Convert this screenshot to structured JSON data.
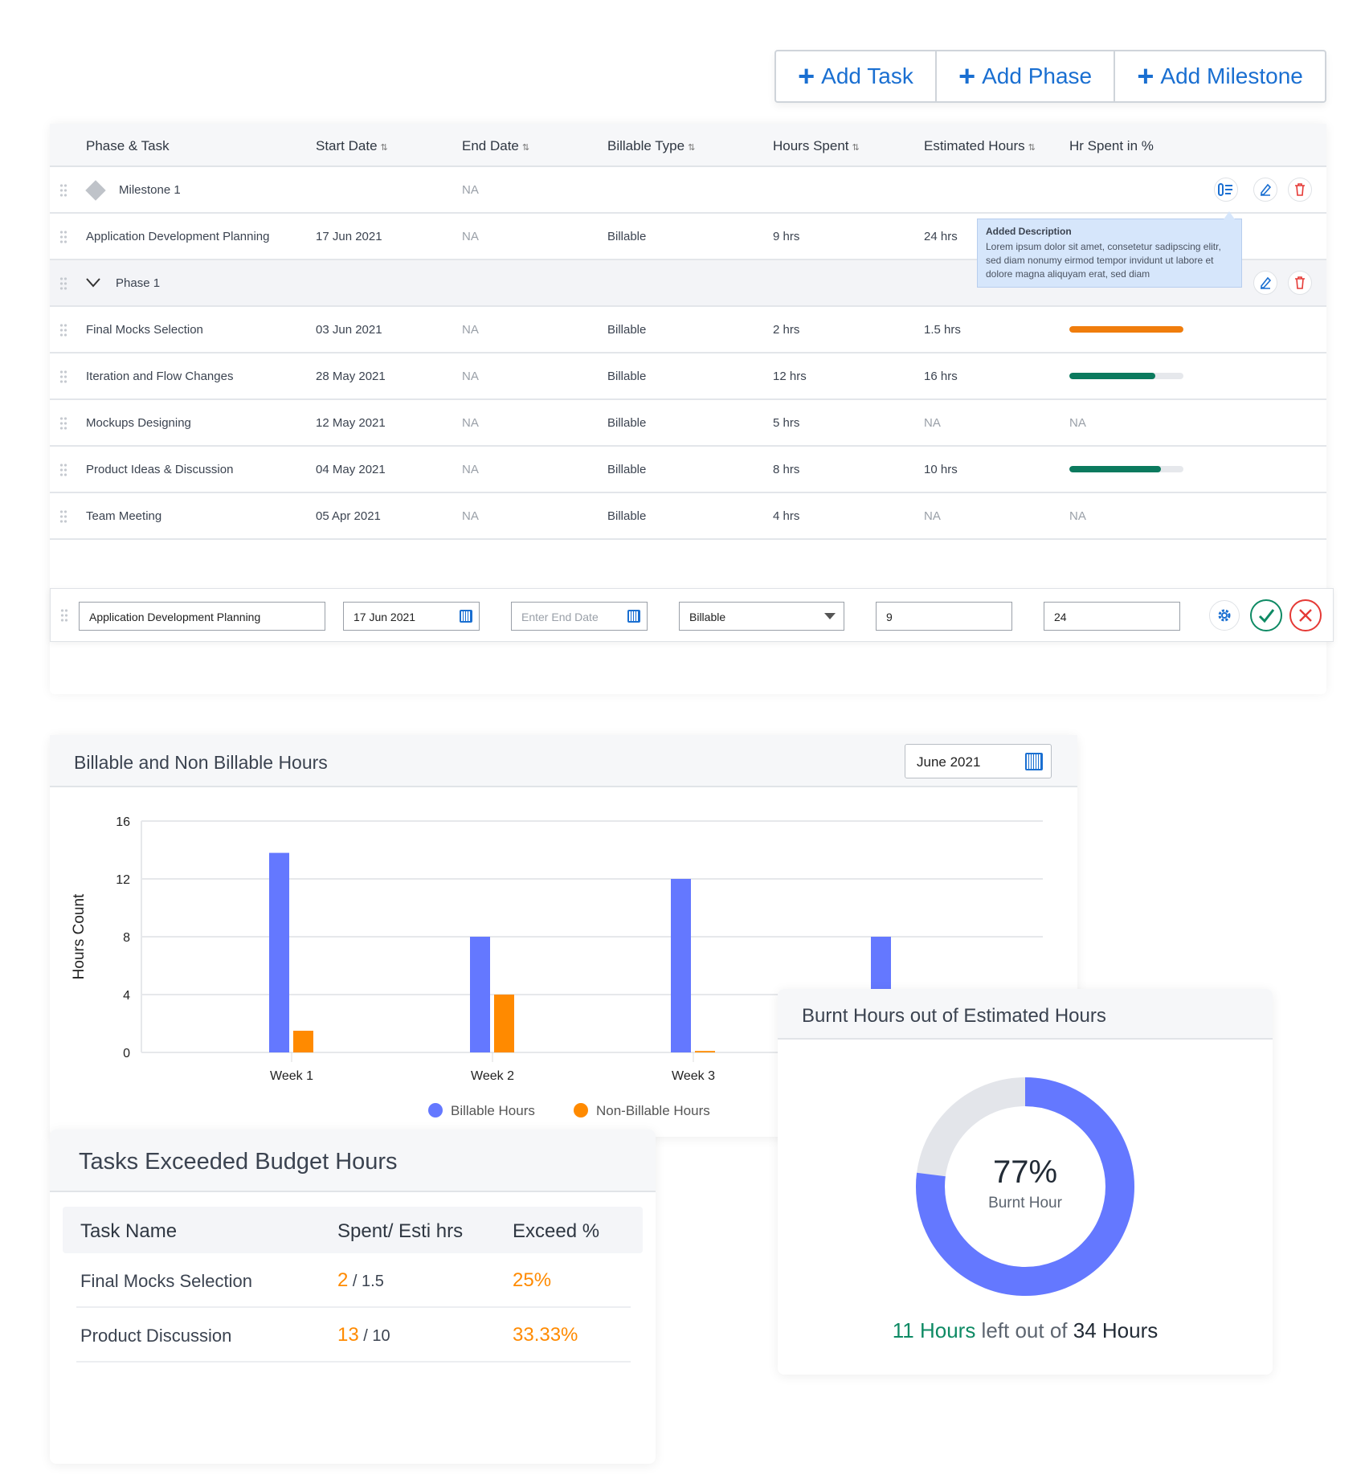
{
  "toolbar": {
    "add_task": "Add Task",
    "add_phase": "Add Phase",
    "add_milestone": "Add Milestone"
  },
  "table": {
    "headers": [
      "Phase & Task",
      "Start Date",
      "End Date",
      "Billable Type",
      "Hours Spent",
      "Estimated Hours",
      "Hr Spent in %"
    ],
    "sort_icon": "⇅",
    "milestone": {
      "name": "Milestone 1",
      "end": "NA"
    },
    "milestone_task": {
      "name": "Application Development Planning",
      "start": "17 Jun 2021",
      "end": "NA",
      "type": "Billable",
      "spent": "9 hrs",
      "est": "24 hrs"
    },
    "phase": {
      "name": "Phase 1"
    },
    "tooltip": {
      "title": "Added Description",
      "text": "Lorem ipsum dolor sit amet, consetetur sadipscing elitr, sed diam nonumy eirmod tempor invidunt ut labore et dolore magna aliquyam erat, sed diam"
    },
    "rows": [
      {
        "name": "Final Mocks Selection",
        "start": "03 Jun 2021",
        "end": "NA",
        "type": "Billable",
        "spent": "2 hrs",
        "est": "1.5 hrs",
        "pct": "",
        "progress": 100,
        "color": "#f07d0c"
      },
      {
        "name": "Iteration and Flow Changes",
        "start": "28 May 2021",
        "end": "NA",
        "type": "Billable",
        "spent": "12 hrs",
        "est": "16 hrs",
        "pct": "",
        "progress": 75,
        "color": "#0b7a5e"
      },
      {
        "name": "Mockups Designing",
        "start": "12 May 2021",
        "end": "NA",
        "type": "Billable",
        "spent": "5 hrs",
        "est": "NA",
        "pct": "NA",
        "progress": null,
        "color": ""
      },
      {
        "name": "Product Ideas & Discussion",
        "start": "04 May 2021",
        "end": "NA",
        "type": "Billable",
        "spent": "8 hrs",
        "est": "10 hrs",
        "pct": "",
        "progress": 80,
        "color": "#0b7a5e"
      },
      {
        "name": "Team Meeting",
        "start": "05 Apr 2021",
        "end": "NA",
        "type": "Billable",
        "spent": "4 hrs",
        "est": "NA",
        "pct": "NA",
        "progress": null,
        "color": ""
      }
    ]
  },
  "edit_row": {
    "name": "Application Development Planning",
    "start": "17 Jun 2021",
    "end_placeholder": "Enter End Date",
    "type": "Billable",
    "spent": "9",
    "est": "24"
  },
  "chart_card": {
    "title": "Billable and Non Billable Hours",
    "month": "June 2021"
  },
  "chart_data": {
    "type": "bar",
    "ylabel": "Hours Count",
    "xlabel": "",
    "ylim": [
      0,
      16
    ],
    "yticks": [
      0,
      4,
      8,
      12,
      16
    ],
    "grid": true,
    "legend": "bottom",
    "categories": [
      "Week 1",
      "Week 2",
      "Week 3",
      ""
    ],
    "series": [
      {
        "name": "Billable Hours",
        "color": "#6478ff",
        "values": [
          13.8,
          8,
          12,
          8
        ]
      },
      {
        "name": "Non-Billable Hours",
        "color": "#ff8a00",
        "values": [
          1.5,
          4,
          0.1,
          null
        ]
      }
    ]
  },
  "burnt": {
    "title": "Burnt Hours out of Estimated Hours",
    "percent_label": "77%",
    "percent": 77,
    "sub": "Burnt Hour",
    "left": "11 Hours",
    "mid": " left out of ",
    "total": "34 Hours",
    "colors": {
      "fill": "#6478ff",
      "track": "#e3e5ea",
      "left": "#0e8a64"
    }
  },
  "tasks": {
    "title": "Tasks Exceeded Budget Hours",
    "headers": [
      "Task Name",
      "Spent/ Esti hrs",
      "Exceed %"
    ],
    "rows": [
      {
        "name": "Final Mocks Selection",
        "spent": "2",
        "est": " / 1.5",
        "exceed": "25%"
      },
      {
        "name": "Product Discussion",
        "spent": "13",
        "est": " / 10",
        "exceed": "33.33%"
      }
    ]
  }
}
